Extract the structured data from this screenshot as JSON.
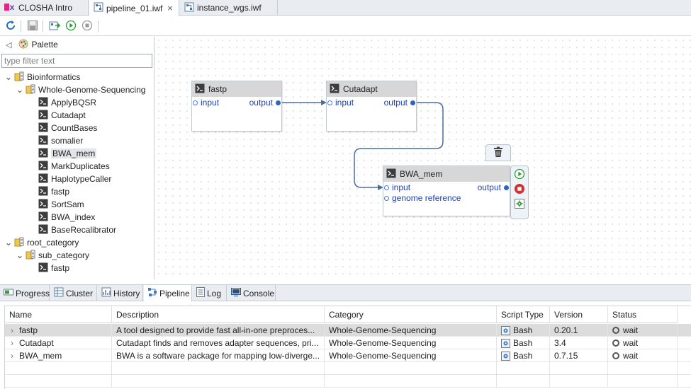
{
  "editor_tabs": [
    {
      "label": "CLOSHA Intro",
      "icon": "closha-logo-icon",
      "active": false,
      "closable": false
    },
    {
      "label": "pipeline_01.iwf",
      "icon": "workflow-file-icon",
      "active": true,
      "closable": true
    },
    {
      "label": "instance_wgs.iwf",
      "icon": "workflow-file-icon",
      "active": false,
      "closable": false
    }
  ],
  "toolbar": [
    "refresh-icon",
    "save-icon",
    "export-icon",
    "run-icon",
    "stop-icon"
  ],
  "palette": {
    "title": "Palette",
    "filter_placeholder": "type filter text",
    "tree": [
      {
        "label": "Bioinformatics",
        "type": "category",
        "level": 0,
        "expanded": true
      },
      {
        "label": "Whole-Genome-Sequencing",
        "type": "subcategory",
        "level": 1,
        "expanded": true
      },
      {
        "label": "ApplyBQSR",
        "type": "tool",
        "level": 2
      },
      {
        "label": "Cutadapt",
        "type": "tool",
        "level": 2
      },
      {
        "label": "CountBases",
        "type": "tool",
        "level": 2
      },
      {
        "label": "somalier",
        "type": "tool",
        "level": 2
      },
      {
        "label": "BWA_mem",
        "type": "tool",
        "level": 2,
        "selected": true
      },
      {
        "label": "MarkDuplicates",
        "type": "tool",
        "level": 2
      },
      {
        "label": "HaplotypeCaller",
        "type": "tool",
        "level": 2
      },
      {
        "label": "fastp",
        "type": "tool",
        "level": 2
      },
      {
        "label": "SortSam",
        "type": "tool",
        "level": 2
      },
      {
        "label": "BWA_index",
        "type": "tool",
        "level": 2
      },
      {
        "label": "BaseRecalibrator",
        "type": "tool",
        "level": 2
      },
      {
        "label": "root_category",
        "type": "category",
        "level": 0,
        "expanded": true
      },
      {
        "label": "sub_category",
        "type": "subcategory",
        "level": 1,
        "expanded": true
      },
      {
        "label": "fastp",
        "type": "tool",
        "level": 2
      }
    ]
  },
  "canvas": {
    "nodes": [
      {
        "id": "fastp",
        "title": "fastp",
        "inputs": [
          "input"
        ],
        "outputs": [
          "output"
        ]
      },
      {
        "id": "cutadapt",
        "title": "Cutadapt",
        "inputs": [
          "input"
        ],
        "outputs": [
          "output"
        ]
      },
      {
        "id": "bwamem",
        "title": "BWA_mem",
        "inputs": [
          "input",
          "genome reference"
        ],
        "outputs": [
          "output"
        ]
      }
    ],
    "selected_node_tools": [
      "trash-icon",
      "run-icon",
      "stop-icon",
      "settings-icon"
    ]
  },
  "view_tabs": [
    {
      "label": "Progress",
      "icon": "progress-icon",
      "active": false
    },
    {
      "label": "Cluster",
      "icon": "cluster-icon",
      "active": false
    },
    {
      "label": "History",
      "icon": "history-icon",
      "active": false
    },
    {
      "label": "Pipeline",
      "icon": "pipeline-icon",
      "active": true
    },
    {
      "label": "Log",
      "icon": "log-icon",
      "active": false
    },
    {
      "label": "Console",
      "icon": "console-icon",
      "active": false
    }
  ],
  "table": {
    "columns": [
      "Name",
      "Description",
      "Category",
      "Script Type",
      "Version",
      "Status"
    ],
    "rows": [
      {
        "name": "fastp",
        "description": "A tool designed to provide fast all-in-one preproces...",
        "category": "Whole-Genome-Sequencing",
        "script_type": "Bash",
        "version": "0.20.1",
        "status": "wait",
        "selected": true
      },
      {
        "name": "Cutadapt",
        "description": "Cutadapt finds and removes adapter sequences, pri...",
        "category": "Whole-Genome-Sequencing",
        "script_type": "Bash",
        "version": "3.4",
        "status": "wait",
        "selected": false
      },
      {
        "name": "BWA_mem",
        "description": "BWA is a software package for mapping low-diverge...",
        "category": "Whole-Genome-Sequencing",
        "script_type": "Bash",
        "version": "0.7.15",
        "status": "wait",
        "selected": false
      }
    ]
  },
  "colors": {
    "port_text": "#1f3fae",
    "port_dot": "#2d62c9",
    "connection": "#4d6f9a",
    "node_header": "#d7d7d7",
    "run_green": "#2e9e3a",
    "stop_red": "#d03030"
  }
}
